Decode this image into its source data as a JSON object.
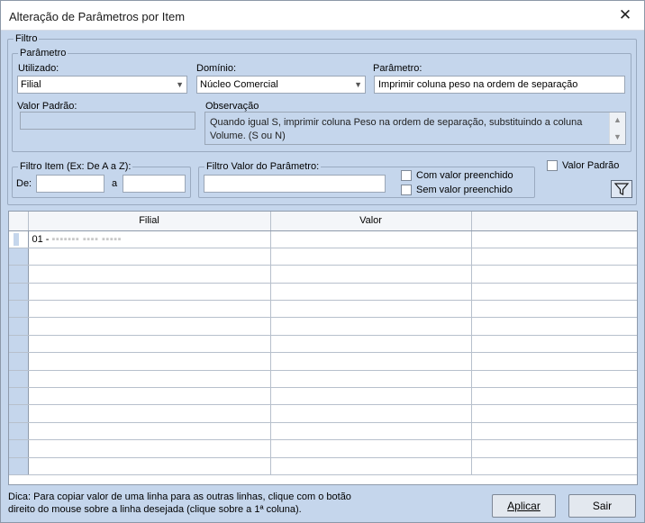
{
  "window": {
    "title": "Alteração de Parâmetros por Item",
    "close_symbol": "✕"
  },
  "filtro": {
    "group_label": "Filtro",
    "parametro": {
      "group_label": "Parâmetro",
      "utilizado_label": "Utilizado:",
      "utilizado_value": "Filial",
      "dominio_label": "Domínio:",
      "dominio_value": "Núcleo Comercial",
      "parametro_label": "Parâmetro:",
      "parametro_value": "Imprimir coluna peso na ordem de separação",
      "valor_padrao_label": "Valor Padrão:",
      "valor_padrao_value": "",
      "observacao_label": "Observação",
      "observacao_text": "Quando igual S, imprimir coluna Peso na ordem de separação, substituindo a coluna Volume. (S ou N)"
    },
    "filtro_item": {
      "group_label": "Filtro Item (Ex: De A a Z):",
      "de_label": "De:",
      "de_value": "",
      "a_label": "a",
      "a_value": ""
    },
    "filtro_valor": {
      "group_label": "Filtro Valor do Parâmetro:",
      "value": "",
      "com_valor_label": "Com valor preenchido",
      "sem_valor_label": "Sem valor preenchido"
    },
    "valor_padrao_check_label": "Valor Padrão",
    "filter_icon": "funnel-icon"
  },
  "grid": {
    "columns": [
      "Filial",
      "Valor",
      ""
    ],
    "rows": [
      {
        "filial_prefix": "01 - ",
        "filial_name": "(nome da filial desfocado)",
        "valor": ""
      }
    ]
  },
  "footer": {
    "hint_line1": "Dica: Para copiar valor de uma linha para as outras linhas, clique com o botão",
    "hint_line2": "direito do mouse sobre a linha desejada (clique sobre a 1ª coluna).",
    "apply_label": "Aplicar",
    "exit_label": "Sair"
  }
}
